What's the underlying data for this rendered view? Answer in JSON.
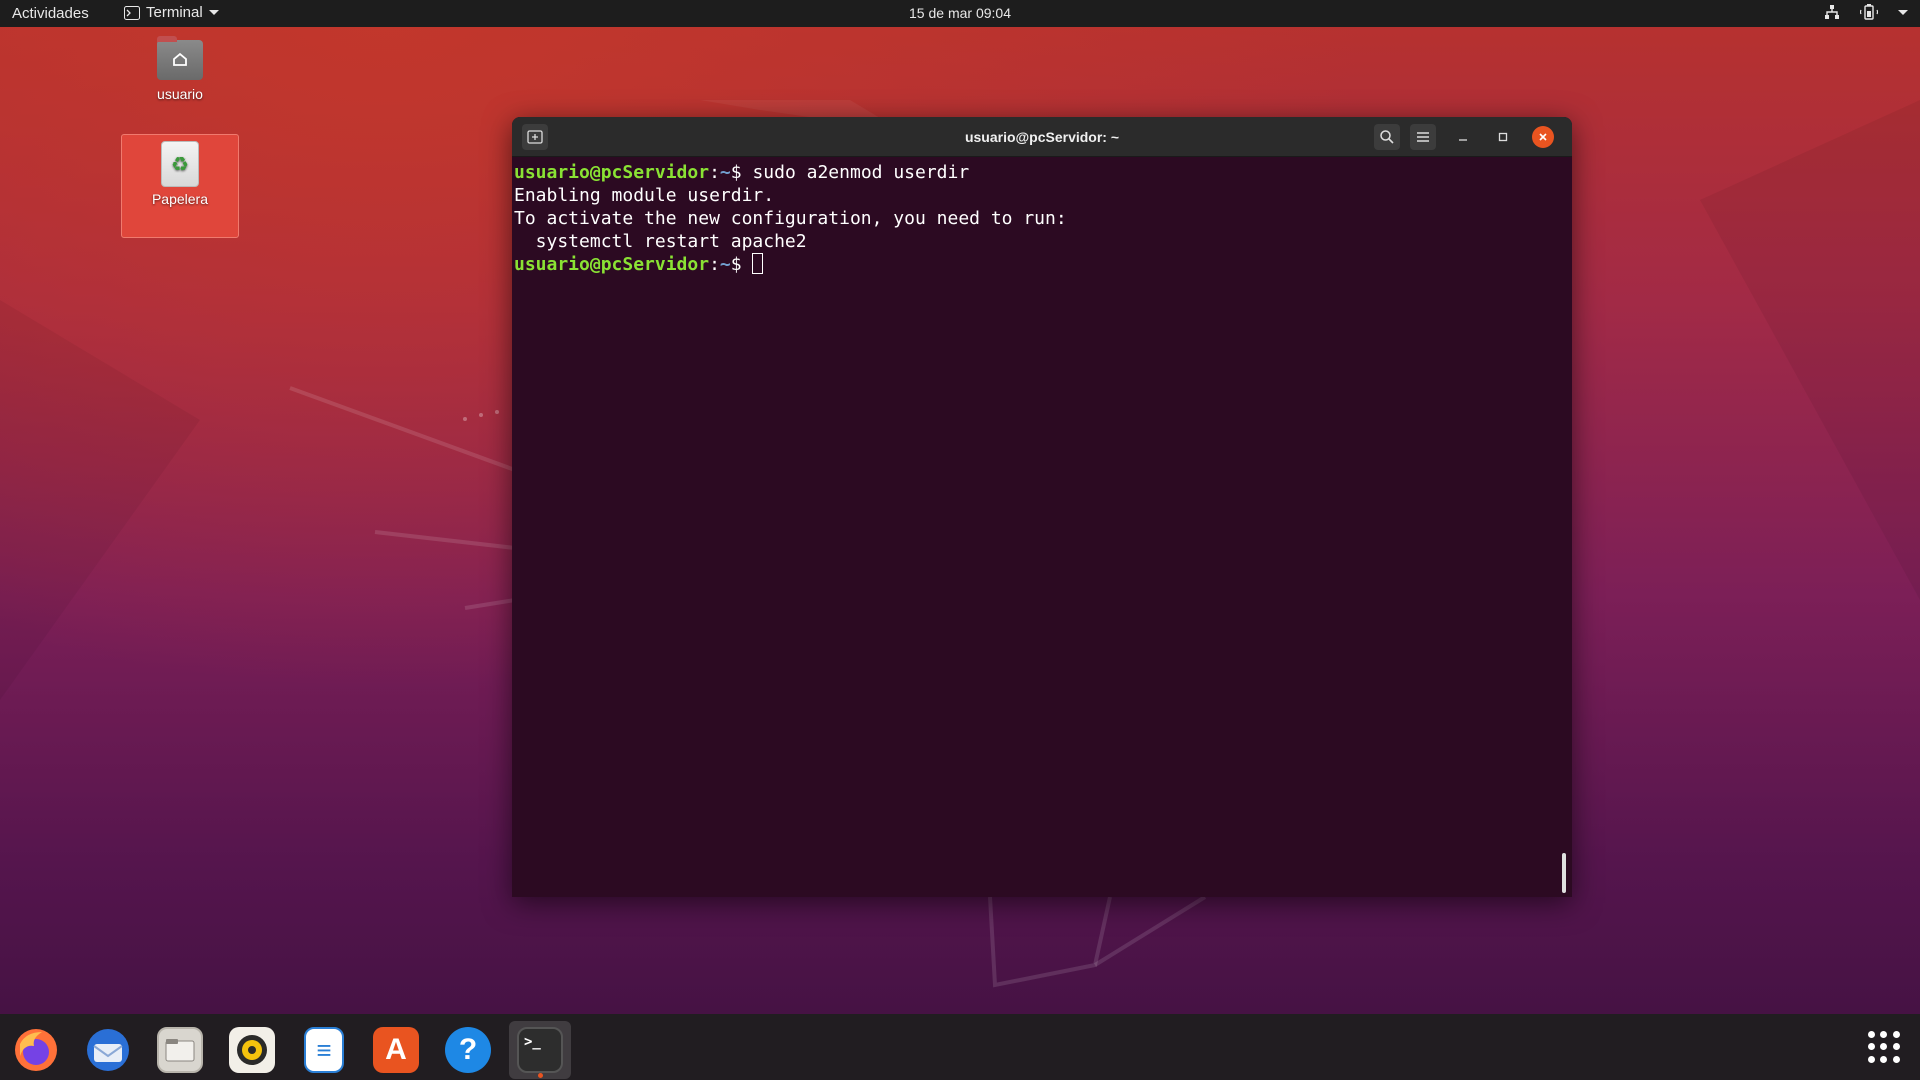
{
  "topbar": {
    "activities": "Actividades",
    "app_menu": "Terminal",
    "clock": "15 de mar  09:04"
  },
  "desktop": {
    "icons": [
      {
        "label": "usuario",
        "icon": "home-folder-icon"
      },
      {
        "label": "Papelera",
        "icon": "trash-icon"
      }
    ]
  },
  "terminal": {
    "title": "usuario@pcServidor: ~",
    "prompt_user": "usuario@pcServidor",
    "prompt_sep": ":",
    "prompt_path": "~",
    "prompt_sym": "$",
    "command": " sudo a2enmod userdir",
    "output": [
      "Enabling module userdir.",
      "To activate the new configuration, you need to run:",
      "  systemctl restart apache2"
    ]
  },
  "dock": {
    "apps": [
      {
        "name": "Firefox",
        "icon": "firefox-icon",
        "color": "#ff7139"
      },
      {
        "name": "Thunderbird",
        "icon": "thunderbird-icon",
        "color": "#2a6fd6"
      },
      {
        "name": "Archivos",
        "icon": "files-icon",
        "color": "#d9d6cf"
      },
      {
        "name": "Rhythmbox",
        "icon": "rhythmbox-icon",
        "color": "#f4c20d"
      },
      {
        "name": "LibreOffice Writer",
        "icon": "writer-icon",
        "color": "#2a7fd6"
      },
      {
        "name": "Ubuntu Software",
        "icon": "software-icon",
        "color": "#e95420"
      },
      {
        "name": "Ayuda",
        "icon": "help-icon",
        "color": "#1e88e5"
      },
      {
        "name": "Terminal",
        "icon": "terminal-icon",
        "color": "#2d2d2d"
      }
    ],
    "help_glyph": "?",
    "writer_glyph": "≡",
    "software_glyph": "A",
    "terminal_glyph": ">_"
  },
  "colors": {
    "ubuntu_orange": "#e95420",
    "terminal_bg": "#2c0a22",
    "prompt_green": "#8ae234",
    "prompt_blue": "#729fcf"
  }
}
